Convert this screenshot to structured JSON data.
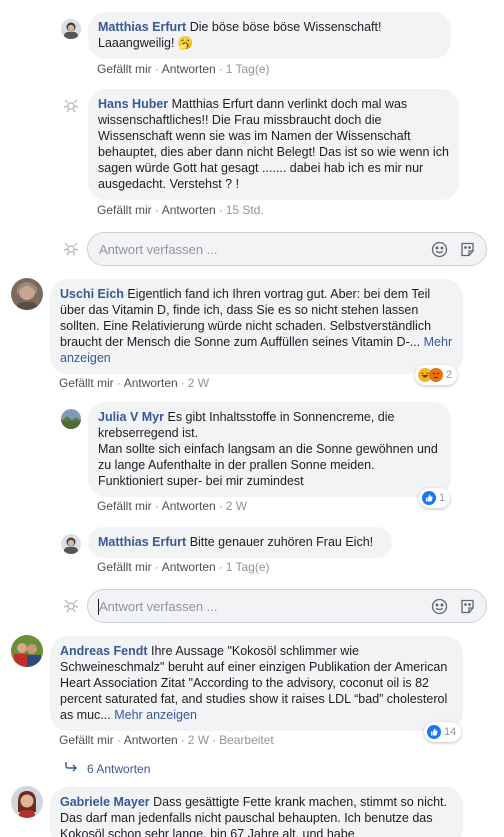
{
  "comments": [
    {
      "name": "Matthias Erfurt",
      "text": "Die böse böse böse Wissenschaft! Laaangweilig! 🥱",
      "actions": {
        "like": "Gefällt mir",
        "reply": "Antworten",
        "time": "1 Tag(e)"
      }
    },
    {
      "name": "Hans Huber",
      "text": "Matthias Erfurt dann verlinkt doch mal was wissenschaftliches!! Die Frau missbraucht doch die Wissenschaft wenn sie was im Namen der Wissenschaft behauptet, dies aber dann nicht Belegt! Das ist so wie wenn ich sagen würde Gott hat gesagt ....... dabei hab ich es mir nur ausgedacht. Verstehst ? !",
      "actions": {
        "like": "Gefällt mir",
        "reply": "Antworten",
        "time": "15 Std."
      }
    },
    {
      "name": "Uschi Eich",
      "text": "Eigentlich fand ich Ihren vortrag gut. Aber: bei dem Teil über das Vitamin D, finde ich, dass Sie es so nicht stehen lassen sollten. Eine Relativierung würde nicht schaden. Selbstverständlich braucht der Mensch die Sonne zum Auffüllen seines Vitamin D-...",
      "more": "Mehr anzeigen",
      "actions": {
        "like": "Gefällt mir",
        "reply": "Antworten",
        "time": "2 W"
      },
      "reactions": {
        "count": "2",
        "icons": [
          "haha",
          "angry"
        ]
      }
    },
    {
      "name": "Julia V Myr",
      "text": "Es gibt Inhaltsstoffe in Sonnencreme, die krebserregend ist.",
      "text2": "Man sollte sich einfach langsam an die Sonne gewöhnen und zu lange Aufenthalte in der prallen Sonne meiden. Funktioniert super- bei mir zumindest",
      "actions": {
        "like": "Gefällt mir",
        "reply": "Antworten",
        "time": "2 W"
      },
      "reactions": {
        "count": "1",
        "icons": [
          "like"
        ]
      }
    },
    {
      "name": "Matthias Erfurt",
      "text": "Bitte genauer zuhören Frau Eich!",
      "actions": {
        "like": "Gefällt mir",
        "reply": "Antworten",
        "time": "1 Tag(e)"
      }
    },
    {
      "name": "Andreas Fendt",
      "text": "Ihre Aussage \"Kokosöl schlimmer wie Schweineschmalz\" beruht auf einer einzigen Publikation der American Heart Association Zitat \"According to the advisory, coconut oil is 82 percent saturated fat, and studies show it raises LDL “bad” cholesterol as muc...",
      "more": "Mehr anzeigen",
      "actions": {
        "like": "Gefällt mir",
        "reply": "Antworten",
        "time": "2 W",
        "edited": "Bearbeitet"
      },
      "reactions": {
        "count": "14",
        "icons": [
          "like"
        ]
      }
    },
    {
      "name": "Gabriele Mayer",
      "text": "Dass gesättigte Fette krank machen, stimmt so nicht. Das darf man jedenfalls nicht pauschal behaupten. Ich benutze das Kokosöl schon sehr lange, bin 67 Jahre alt, und habe"
    }
  ],
  "reply_inputs": [
    {
      "placeholder": "Antwort verfassen ..."
    },
    {
      "placeholder": "Antwort verfassen ..."
    }
  ],
  "replies_link": {
    "label": "6 Antworten"
  },
  "colors": {
    "link": "#385898",
    "bubble": "#f2f3f5",
    "meta": "#90949c",
    "like_blue": "#1877f2"
  }
}
